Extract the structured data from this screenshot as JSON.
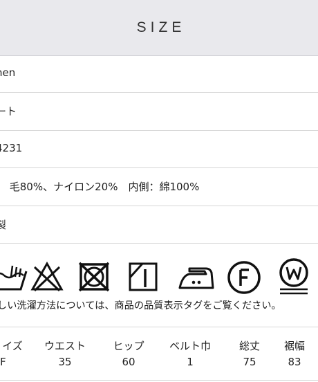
{
  "header": {
    "title": "SIZE"
  },
  "rows": [
    {
      "text": "nen"
    },
    {
      "text": "ート"
    },
    {
      "text": "4231"
    },
    {
      "text": "： 毛80%、ナイロン20%　内側：綿100%"
    },
    {
      "text": "製"
    }
  ],
  "care": {
    "icons": [
      "hand-wash-icon",
      "no-bleach-icon",
      "no-tumble-dry-icon",
      "line-dry-shade-icon",
      "iron-low-icon",
      "dry-clean-f-icon",
      "wet-clean-w-icon"
    ],
    "note": "しい洗濯方法については、商品の品質表示タグをご覧ください。"
  },
  "size_table": {
    "headers": [
      "イズ",
      "ウエスト",
      "ヒップ",
      "ベルト巾",
      "総丈",
      "裾幅"
    ],
    "values": [
      "F",
      "35",
      "60",
      "1",
      "75",
      "83"
    ]
  }
}
